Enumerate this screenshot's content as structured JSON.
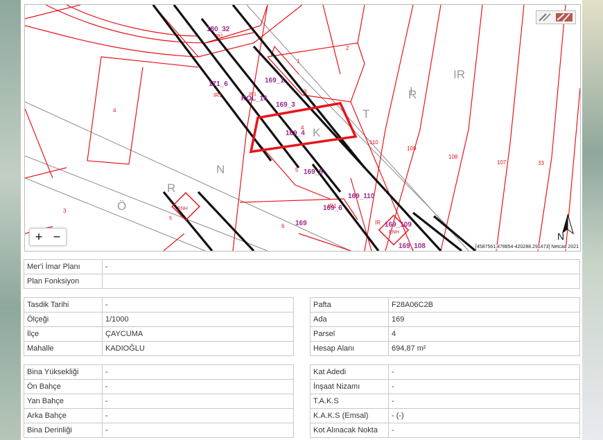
{
  "map": {
    "coordinates": "[4587561.478854-420288.291473] Netcad 2021",
    "north": "N",
    "zoom_in": "+",
    "zoom_out": "−",
    "parcel_labels": [
      "180_32",
      "1",
      "2",
      "IR1",
      "169_1",
      "171_6",
      "IR1",
      "KOL_16",
      "169_3",
      "IR1",
      "3",
      "169_4",
      "4",
      "IR",
      "R",
      "T",
      "K",
      "110",
      "109",
      "108",
      "107",
      "33",
      "4",
      "5",
      "169_5",
      "N",
      "R",
      "IR1",
      "169_110",
      "Ö",
      "169_6",
      "3",
      "ENH",
      "5",
      "6",
      "169",
      "IR",
      "169_109",
      "ENH",
      "169_108",
      "I"
    ]
  },
  "plan": [
    {
      "label": "Mer'i İmar Planı",
      "value": "-"
    },
    {
      "label": "Plan Fonksiyon",
      "value": ""
    }
  ],
  "left1": [
    {
      "label": "Tasdik Tarihi",
      "value": "-"
    },
    {
      "label": "Ölçeği",
      "value": "1/1000"
    },
    {
      "label": "İlçe",
      "value": "ÇAYCUMA"
    },
    {
      "label": "Mahalle",
      "value": "KADIOĞLU"
    }
  ],
  "right1": [
    {
      "label": "Pafta",
      "value": "F28A06C2B"
    },
    {
      "label": "Ada",
      "value": "169"
    },
    {
      "label": "Parsel",
      "value": "4"
    },
    {
      "label": "Hesap Alanı",
      "value": "694,87 m²"
    }
  ],
  "left2": [
    {
      "label": "Bina Yüksekliği",
      "value": "-"
    },
    {
      "label": "Ön Bahçe",
      "value": "-"
    },
    {
      "label": "Yan Bahçe",
      "value": "-"
    },
    {
      "label": "Arka Bahçe",
      "value": "-"
    },
    {
      "label": "Bina Derinliği",
      "value": "-"
    }
  ],
  "right2": [
    {
      "label": "Kat Adedi",
      "value": "-"
    },
    {
      "label": "İnşaat Nizamı",
      "value": "-"
    },
    {
      "label": "T.A.K.S",
      "value": "-"
    },
    {
      "label": "K.A.K.S (Emsal)",
      "value": "- (-)"
    },
    {
      "label": "Kot Alınacak Nokta",
      "value": "-"
    }
  ],
  "colors": {
    "parcel": "#e8141b",
    "label": "#9b2a8c",
    "road": "#111111",
    "highlight": "#e8141b"
  }
}
